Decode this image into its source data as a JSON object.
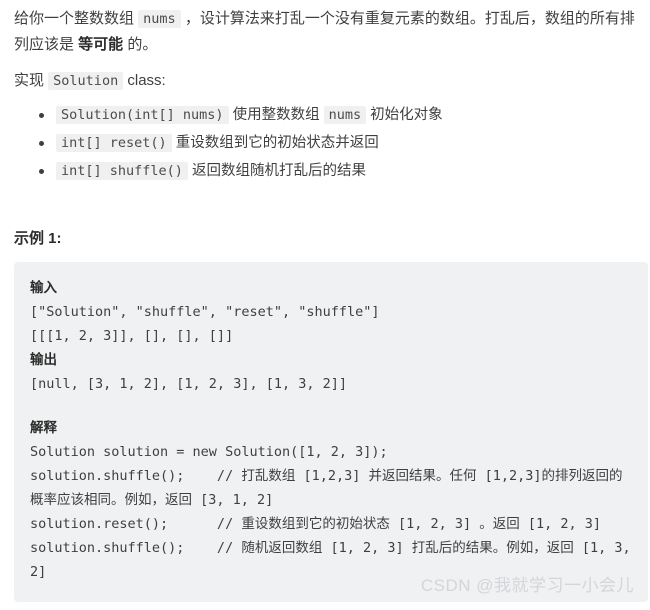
{
  "problem": {
    "intro_part1": "给你一个整数数组 ",
    "intro_code1": "nums",
    "intro_part2": " ，设计算法来打乱一个没有重复元素的数组。打乱后，数组的所有排列应该是 ",
    "intro_bold": "等可能",
    "intro_part3": " 的。",
    "impl_prefix": "实现 ",
    "impl_code": "Solution",
    "impl_suffix": " class:",
    "methods": [
      {
        "signature": "Solution(int[] nums)",
        "description": " 使用整数数组 ",
        "code2": "nums",
        "description2": " 初始化对象"
      },
      {
        "signature": "int[] reset()",
        "description": " 重设数组到它的初始状态并返回",
        "code2": "",
        "description2": ""
      },
      {
        "signature": "int[] shuffle()",
        "description": " 返回数组随机打乱后的结果",
        "code2": "",
        "description2": ""
      }
    ]
  },
  "example": {
    "title": "示例 1:",
    "input_label": "输入",
    "input_lines": "[\"Solution\", \"shuffle\", \"reset\", \"shuffle\"]\n[[[1, 2, 3]], [], [], []]",
    "output_label": "输出",
    "output_lines": "[null, [3, 1, 2], [1, 2, 3], [1, 3, 2]]",
    "explain_label": "解释",
    "explain_lines": "Solution solution = new Solution([1, 2, 3]);\nsolution.shuffle();    // 打乱数组 [1,2,3] 并返回结果。任何 [1,2,3]的排列返回的概率应该相同。例如，返回 [3, 1, 2]\nsolution.reset();      // 重设数组到它的初始状态 [1, 2, 3] 。返回 [1, 2, 3]\nsolution.shuffle();    // 随机返回数组 [1, 2, 3] 打乱后的结果。例如，返回 [1, 3, 2]"
  },
  "watermark": {
    "text": "CSDN @我就学习一小会儿"
  },
  "colors": {
    "code_bg": "#f0f1f2",
    "inline_code_bg": "#f0f0f0",
    "text": "#3f3f3f",
    "watermark": "#d3d6d9"
  }
}
